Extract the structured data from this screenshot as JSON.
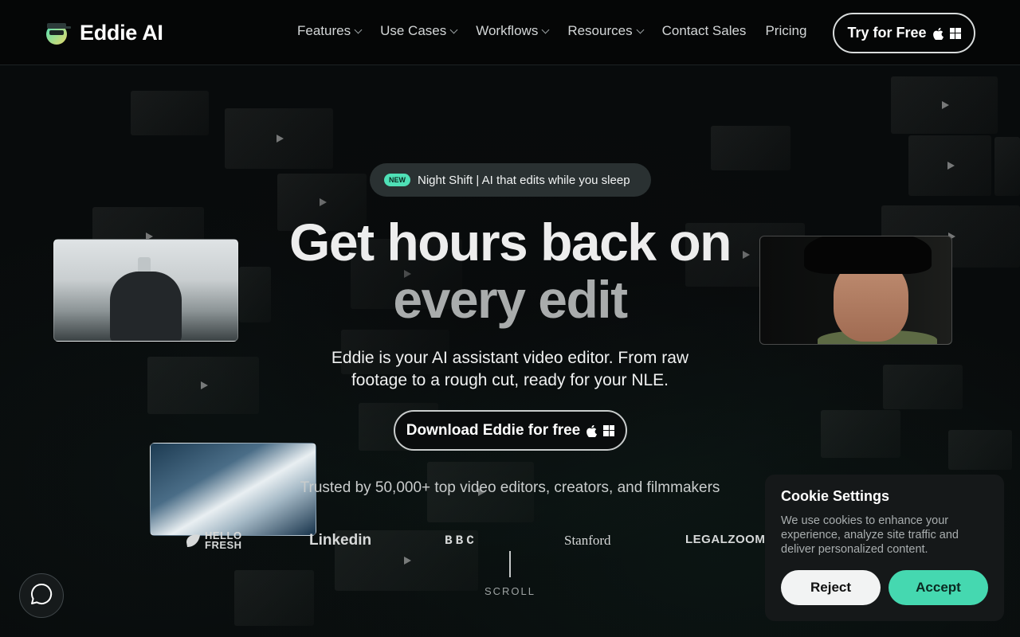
{
  "brand": {
    "name": "Eddie AI"
  },
  "nav": {
    "items": [
      {
        "label": "Features",
        "dropdown": true
      },
      {
        "label": "Use Cases",
        "dropdown": true
      },
      {
        "label": "Workflows",
        "dropdown": true
      },
      {
        "label": "Resources",
        "dropdown": true
      },
      {
        "label": "Contact Sales",
        "dropdown": false
      },
      {
        "label": "Pricing",
        "dropdown": false
      }
    ],
    "cta_label": "Try for Free"
  },
  "hero": {
    "badge_tag": "NEW",
    "badge_text": "Night Shift | AI that edits while you sleep",
    "title_line1": "Get hours back on",
    "title_line2": "every edit",
    "subtitle": "Eddie is your AI assistant video editor. From raw footage to a rough cut, ready for your NLE.",
    "download_label": "Download Eddie for free",
    "trusted_text": "Trusted by 50,000+ top video editors, creators, and filmmakers"
  },
  "logos": [
    "HELLO FRESH",
    "Linkedin",
    "BBC",
    "Stanford",
    "LEGALZOOM"
  ],
  "scroll_label": "SCROLL",
  "cookie": {
    "title": "Cookie Settings",
    "text": "We use cookies to enhance your experience, analyze site traffic and deliver personalized content.",
    "reject_label": "Reject",
    "accept_label": "Accept"
  },
  "colors": {
    "accent": "#45d8b0",
    "background": "#0a0d0e"
  },
  "icons": {
    "os": [
      "apple-icon",
      "windows-icon"
    ],
    "chat": "chat-bubble-icon"
  }
}
